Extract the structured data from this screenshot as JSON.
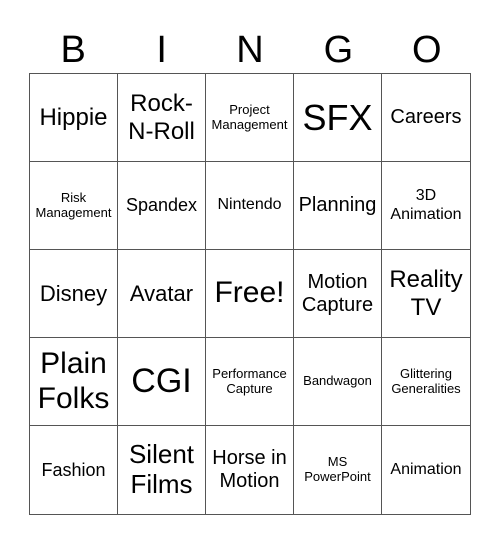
{
  "header": [
    "B",
    "I",
    "N",
    "G",
    "O"
  ],
  "cells": [
    "Hippie",
    "Rock-N-Roll",
    "Project Management",
    "SFX",
    "Careers",
    "Risk Management",
    "Spandex",
    "Nintendo",
    "Planning",
    "3D Animation",
    "Disney",
    "Avatar",
    "Free!",
    "Motion Capture",
    "Reality TV",
    "Plain Folks",
    "CGI",
    "Performance Capture",
    "Bandwagon",
    "Glittering Generalities",
    "Fashion",
    "Silent Films",
    "Horse in Motion",
    "MS PowerPoint",
    "Animation"
  ]
}
